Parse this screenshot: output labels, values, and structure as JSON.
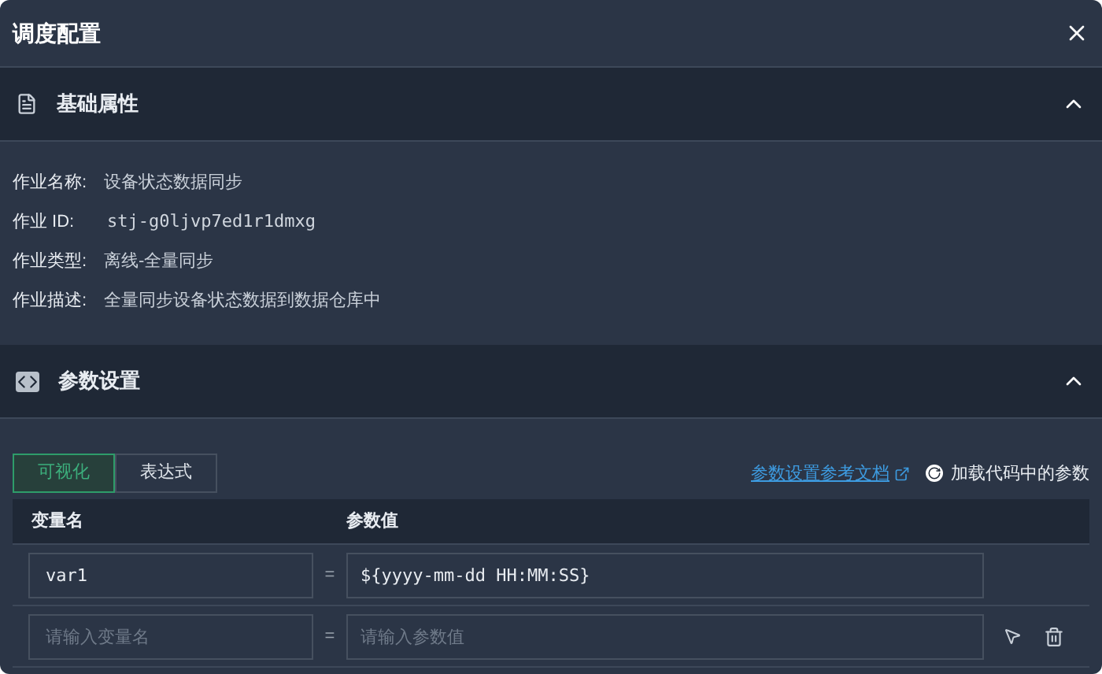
{
  "dialog": {
    "title": "调度配置"
  },
  "basic_section": {
    "title": "基础属性",
    "expanded": true,
    "fields": [
      {
        "label": "作业名称:",
        "value": "设备状态数据同步",
        "mono": false
      },
      {
        "label": "作业 ID:",
        "value": "stj-g0ljvp7ed1r1dmxg",
        "mono": true
      },
      {
        "label": "作业类型:",
        "value": "离线-全量同步",
        "mono": false
      },
      {
        "label": "作业描述:",
        "value": "全量同步设备状态数据到数据仓库中",
        "mono": false
      }
    ]
  },
  "param_section": {
    "title": "参数设置",
    "expanded": true,
    "tabs": [
      {
        "label": "可视化",
        "selected": true
      },
      {
        "label": "表达式",
        "selected": false
      }
    ],
    "doc_link": "参数设置参考文档",
    "load_button": "加载代码中的参数",
    "columns": [
      "变量名",
      "参数值"
    ],
    "rows": [
      {
        "name": {
          "value": "var1"
        },
        "equals": "=",
        "param": {
          "value": "${yyyy-mm-dd HH:MM:SS}"
        },
        "show_actions": false
      },
      {
        "name": {
          "placeholder": "请输入变量名"
        },
        "equals": "=",
        "param": {
          "placeholder": "请输入参数值"
        },
        "show_actions": true
      }
    ]
  }
}
